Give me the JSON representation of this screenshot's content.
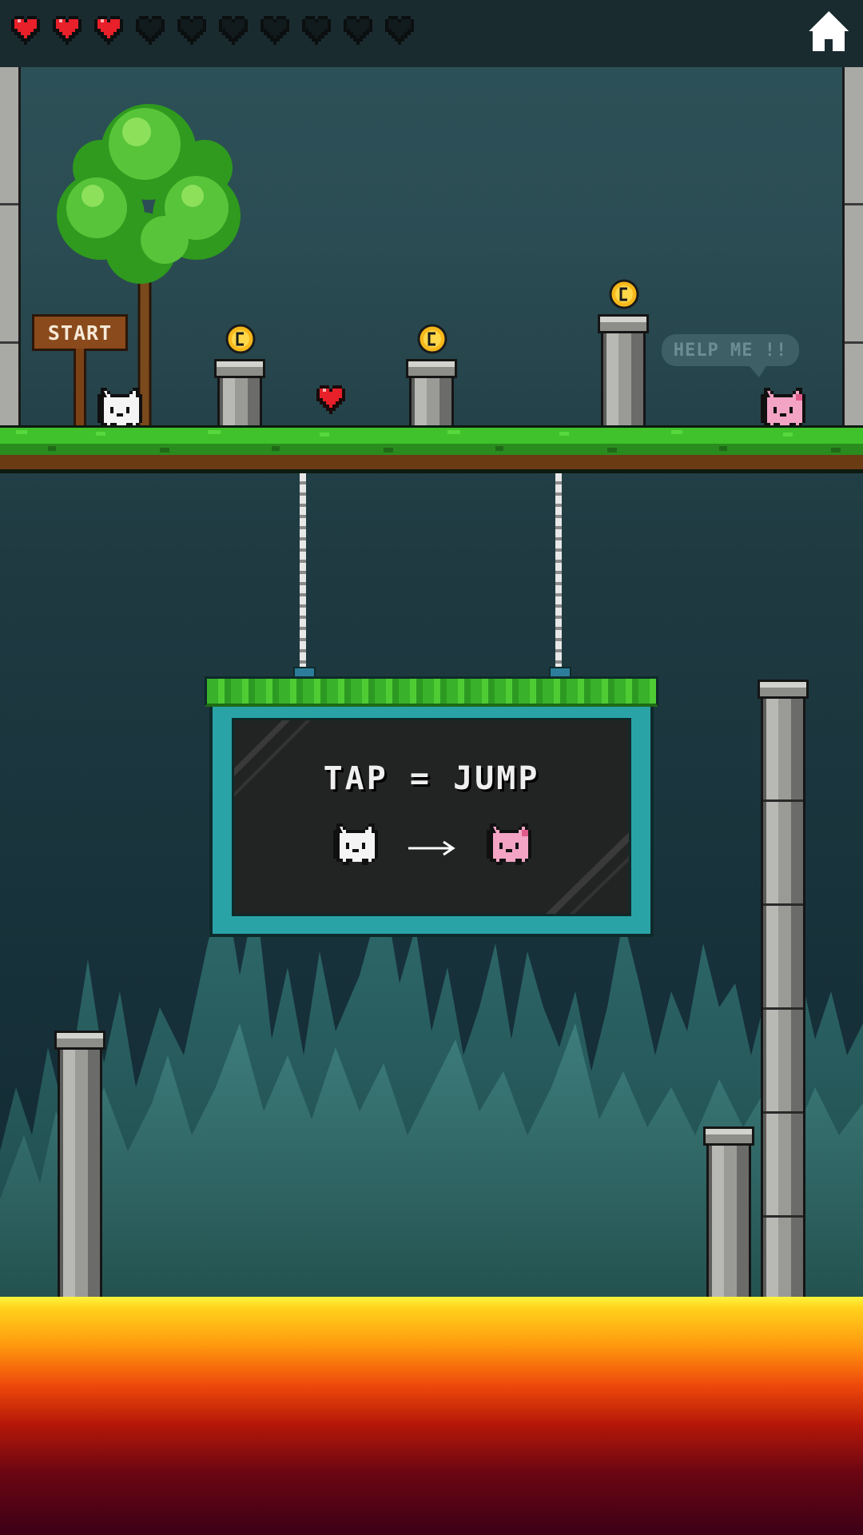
{
  "hud": {
    "hearts_filled": 3,
    "hearts_total": 10,
    "heart_color": "#e8202a",
    "heart_empty_color": "#111a1c",
    "home_icon": "home-icon"
  },
  "level": {
    "start_sign": "START",
    "help_bubble": "HELP ME !!",
    "coins": 3,
    "coin_color": "#f7b81a",
    "player": "white-cat",
    "goal": "pink-cat"
  },
  "tutorial": {
    "instruction": "TAP = JUMP"
  },
  "colors": {
    "grass": "#3fc22b",
    "dirt": "#6b3c14",
    "lava_top": "#fff53c",
    "lava_bottom": "#3c0016",
    "board_frame": "#2aa3a6"
  }
}
